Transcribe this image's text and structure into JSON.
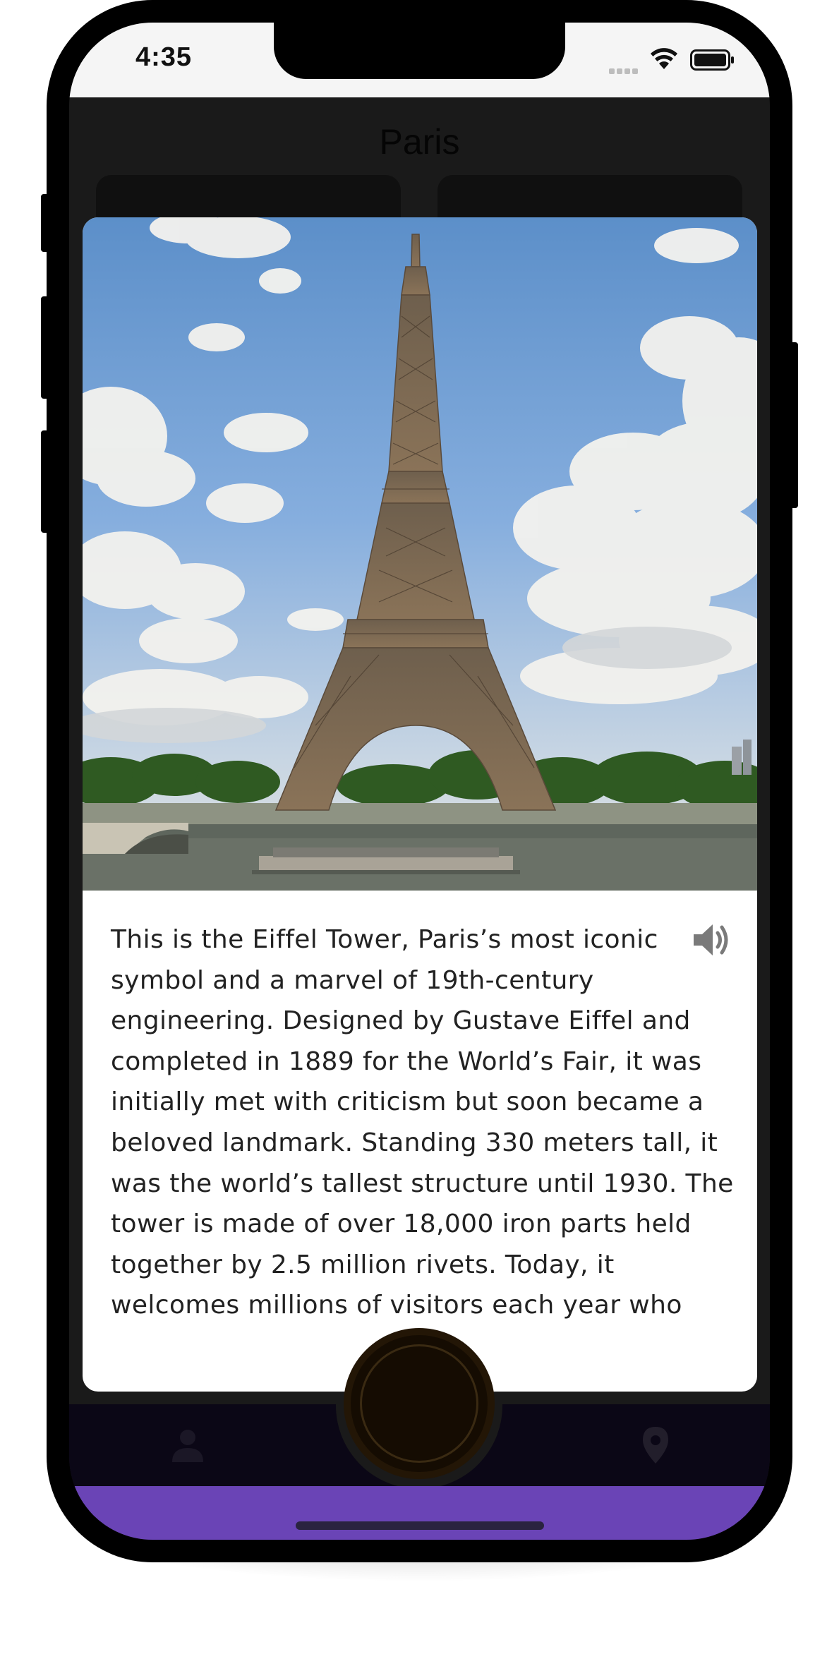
{
  "status_bar": {
    "time": "4:35",
    "icons": [
      "cellular-signal-icon",
      "wifi-icon",
      "battery-icon"
    ]
  },
  "header": {
    "title": "Paris"
  },
  "modal": {
    "image": {
      "subject": "Eiffel Tower photo"
    },
    "description": "This is the Eiffel Tower, Paris’s most iconic symbol and a marvel of 19th-century engineering. Designed by Gustave Eiffel and completed in 1889 for the World’s Fair, it was initially met with criticism but soon became a beloved landmark. Standing 330 meters tall, it was the world’s tallest structure until 1930. The tower is made of over 18,000 iron parts held together by 2.5 million rivets. Today, it welcomes millions of visitors each year who",
    "audio_icon": "speaker-icon"
  },
  "tab_bar": {
    "items": [
      {
        "icon": "person-icon"
      },
      {
        "icon": "center-action-button"
      },
      {
        "icon": "map-pin-icon"
      }
    ]
  },
  "colors": {
    "accent_purple": "#6a44b6",
    "screen_background": "#1a1a1a",
    "modal_background": "#ffffff",
    "tab_bar_background": "#0b0716",
    "center_button": "#150c02"
  }
}
